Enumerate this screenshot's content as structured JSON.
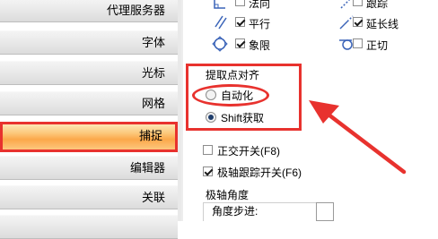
{
  "nav": {
    "items": [
      {
        "label": "代理服务器",
        "active": false
      },
      {
        "label": "字体",
        "active": false
      },
      {
        "label": "光标",
        "active": false
      },
      {
        "label": "网格",
        "active": false
      },
      {
        "label": "捕捉",
        "active": true
      },
      {
        "label": "编辑器",
        "active": false
      },
      {
        "label": "关联",
        "active": false
      }
    ]
  },
  "snap_modes": {
    "normal": {
      "label": "法向",
      "checked": false
    },
    "trace": {
      "label": "跟踪",
      "checked": false
    },
    "parallel": {
      "label": "平行",
      "checked": true
    },
    "extension": {
      "label": "延长线",
      "checked": true
    },
    "quadrant": {
      "label": "象限",
      "checked": true
    },
    "tangent": {
      "label": "正切",
      "checked": false
    }
  },
  "pick_point": {
    "title": "提取点对齐",
    "auto_label": "自动化",
    "auto_selected": false,
    "shift_label": "Shift获取",
    "shift_selected": true
  },
  "ortho": {
    "label": "正交开关(F8)",
    "checked": false
  },
  "polar": {
    "label": "极轴跟踪开关(F6)",
    "checked": true
  },
  "polar_angle": {
    "title": "极轴角度",
    "step_label": "角度步进:"
  },
  "colors": {
    "highlight": "#e8322e",
    "active_nav": "#fba84a"
  }
}
